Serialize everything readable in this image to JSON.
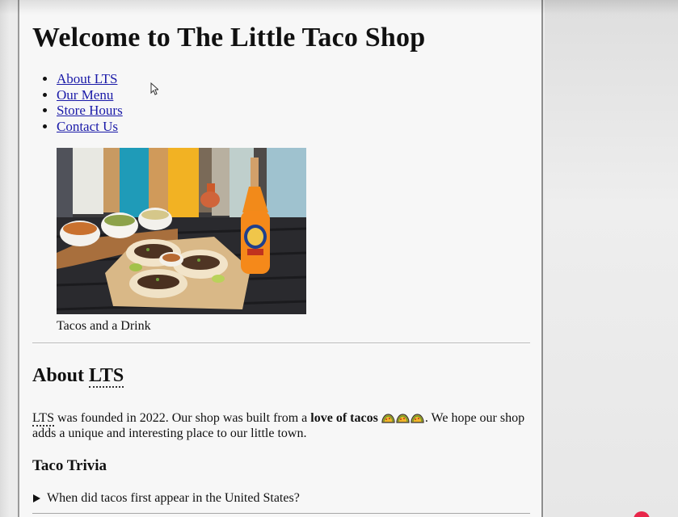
{
  "page": {
    "title": "Welcome to The Little Taco Shop"
  },
  "nav": {
    "items": [
      {
        "label": "About LTS"
      },
      {
        "label": "Our Menu"
      },
      {
        "label": "Store Hours"
      },
      {
        "label": "Contact Us"
      }
    ]
  },
  "figure": {
    "caption": "Tacos and a Drink"
  },
  "about": {
    "heading_abbr": "LTS",
    "heading_prefix": "About ",
    "text_abbr": "LTS",
    "text_part1": " was founded in 2022. Our shop was built from a ",
    "text_bold": "love of tacos",
    "text_part2": ". We hope our shop adds a unique and interesting place to our little town."
  },
  "trivia": {
    "heading": "Taco Trivia",
    "question": "When did tacos first appear in the United States?"
  },
  "icons": {
    "nav_bullet": "disc",
    "cursor": "arrow-cursor-icon",
    "emoji": "taco-icon",
    "disclosure": "triangle-right-icon"
  },
  "colors": {
    "link": "#1a1aa8",
    "page_bg": "#f7f7f7",
    "record": "#e8264a"
  }
}
